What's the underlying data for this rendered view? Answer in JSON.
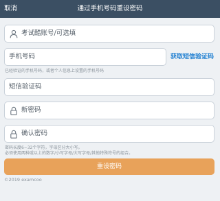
{
  "header": {
    "cancel_label": "取消",
    "title": "通过手机号码重设密码"
  },
  "form": {
    "account_placeholder": "考试酷账号/可选填",
    "phone_placeholder": "手机号码",
    "get_code_label": "获取短信验证码",
    "phone_hint": "已经验证的手机号码，或者个人信息上设置的手机号码",
    "code_placeholder": "短信验证码",
    "new_password_placeholder": "新密码",
    "confirm_password_placeholder": "确认密码",
    "password_hint_1": "密码长度6~32个字符，字母区分大小写。",
    "password_hint_2": "必须使用两种或以上的数字/小写字母/大写字母/其他特殊符号的组合。",
    "submit_label": "重设密码"
  },
  "footer": {
    "copyright": "©2019 examcoo"
  },
  "colors": {
    "header_bg": "#3b4f63",
    "accent_link": "#1f7fd1",
    "submit_bg": "#e8a25a"
  }
}
